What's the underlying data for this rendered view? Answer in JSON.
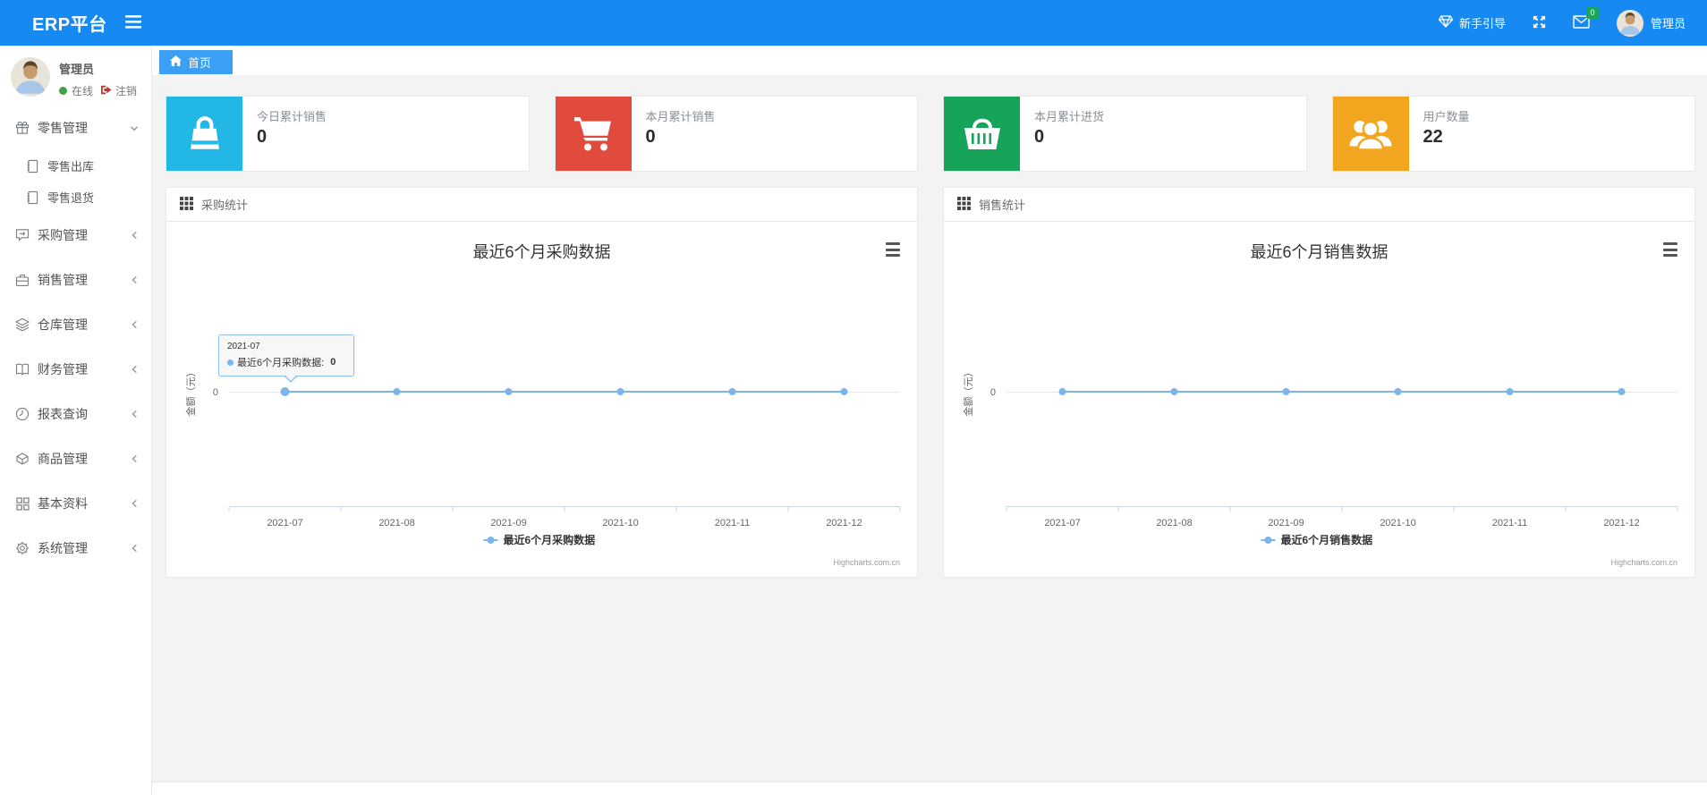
{
  "navbar": {
    "brand": "ERP平台",
    "guide_label": "新手引导",
    "mail_badge": "0",
    "user_name": "管理员"
  },
  "sidebar": {
    "user": {
      "name": "管理员",
      "status": "在线",
      "logout": "注销"
    },
    "menu": [
      {
        "id": "retail",
        "icon": "gift",
        "label": "零售管理",
        "expanded": true,
        "children": [
          {
            "id": "retail-out",
            "icon": "journal",
            "label": "零售出库"
          },
          {
            "id": "retail-return",
            "icon": "journal",
            "label": "零售退货"
          }
        ]
      },
      {
        "id": "purchase",
        "icon": "comment-arrow",
        "label": "采购管理",
        "expanded": false
      },
      {
        "id": "sales",
        "icon": "briefcase",
        "label": "销售管理",
        "expanded": false
      },
      {
        "id": "warehouse",
        "icon": "layers",
        "label": "仓库管理",
        "expanded": false
      },
      {
        "id": "finance",
        "icon": "book-open",
        "label": "财务管理",
        "expanded": false
      },
      {
        "id": "report",
        "icon": "clock",
        "label": "报表查询",
        "expanded": false
      },
      {
        "id": "goods",
        "icon": "box",
        "label": "商品管理",
        "expanded": false
      },
      {
        "id": "basic",
        "icon": "th-large",
        "label": "基本资料",
        "expanded": false
      },
      {
        "id": "system",
        "icon": "gear",
        "label": "系统管理",
        "expanded": false
      }
    ]
  },
  "breadcrumb": {
    "home_label": "首页"
  },
  "cards": [
    {
      "id": "today-sales",
      "label": "今日累计销售",
      "value": "0",
      "color": "#23b7e5",
      "icon": "shopping-bag"
    },
    {
      "id": "month-sales",
      "label": "本月累计销售",
      "value": "0",
      "color": "#e04b3e",
      "icon": "shopping-cart"
    },
    {
      "id": "month-purchase",
      "label": "本月累计进货",
      "value": "0",
      "color": "#17a35a",
      "icon": "shopping-basket"
    },
    {
      "id": "user-count",
      "label": "用户数量",
      "value": "22",
      "color": "#f2a51f",
      "icon": "users"
    }
  ],
  "panels": [
    {
      "id": "purchase-stats",
      "header": "采购统计"
    },
    {
      "id": "sales-stats",
      "header": "销售统计"
    }
  ],
  "chart_data": [
    {
      "type": "line",
      "title": "最近6个月采购数据",
      "categories": [
        "2021-07",
        "2021-08",
        "2021-09",
        "2021-10",
        "2021-11",
        "2021-12"
      ],
      "series": [
        {
          "name": "最近6个月采购数据",
          "values": [
            0,
            0,
            0,
            0,
            0,
            0
          ]
        }
      ],
      "xlabel": "",
      "ylabel": "金额（元）",
      "yticks": [
        "0"
      ],
      "grid": true,
      "legend_position": "bottom",
      "color": "#7cb5ec",
      "credit": "Highcharts.com.cn",
      "tooltip": {
        "date": "2021-07",
        "label": "最近6个月采购数据",
        "value": "0"
      }
    },
    {
      "type": "line",
      "title": "最近6个月销售数据",
      "categories": [
        "2021-07",
        "2021-08",
        "2021-09",
        "2021-10",
        "2021-11",
        "2021-12"
      ],
      "series": [
        {
          "name": "最近6个月销售数据",
          "values": [
            0,
            0,
            0,
            0,
            0,
            0
          ]
        }
      ],
      "xlabel": "",
      "ylabel": "金额（元）",
      "yticks": [
        "0"
      ],
      "grid": true,
      "legend_position": "bottom",
      "color": "#7cb5ec",
      "credit": "Highcharts.com.cn",
      "tooltip": null
    }
  ]
}
